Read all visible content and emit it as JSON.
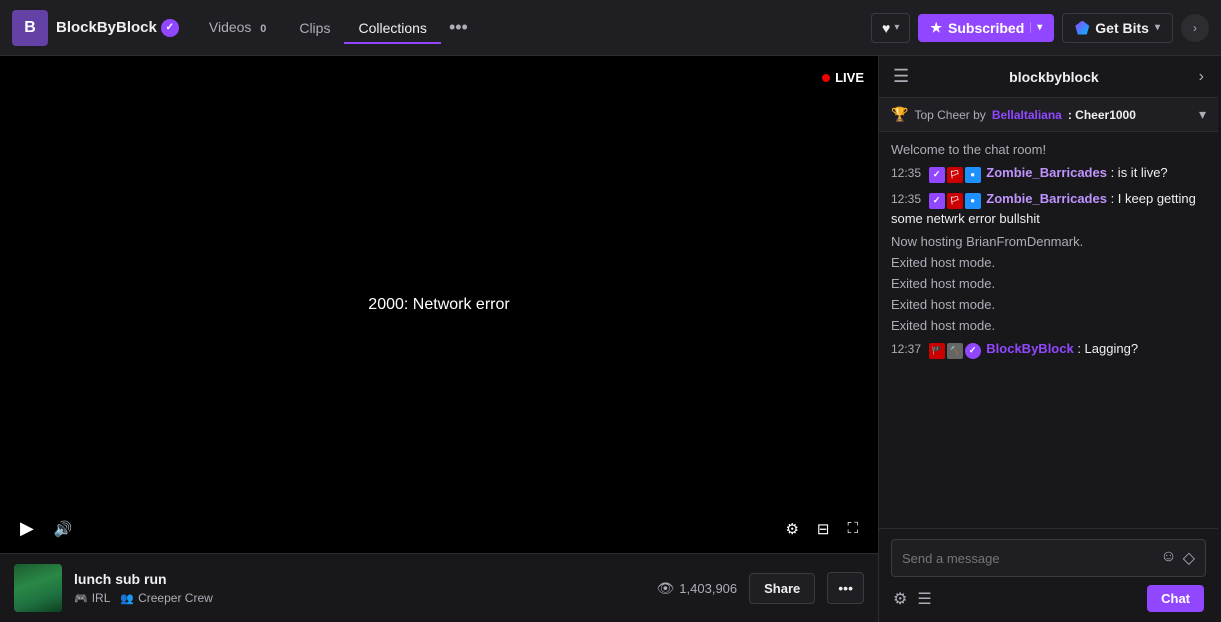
{
  "nav": {
    "channel_logo_text": "B",
    "channel_name": "BlockByBlock",
    "verified": true,
    "links": [
      {
        "label": "Videos",
        "badge": "0",
        "active": false
      },
      {
        "label": "Clips",
        "badge": "",
        "active": false
      },
      {
        "label": "Collections",
        "badge": "",
        "active": true
      }
    ],
    "more_label": "•••",
    "heart_label": "♥",
    "subscribe_label": "Subscribed",
    "get_bits_label": "Get Bits"
  },
  "video": {
    "live_label": "LIVE",
    "error_message": "2000: Network error",
    "play_icon": "▶",
    "volume_icon": "🔊"
  },
  "stream": {
    "title": "lunch sub run",
    "tag_irl": "IRL",
    "tag_crew": "Creeper Crew",
    "viewer_count": "1,403,906",
    "share_label": "Share"
  },
  "chat": {
    "channel_name": "blockbyblock",
    "top_cheer_label": "Top Cheer by",
    "top_cheer_user": "BellaItaliana",
    "top_cheer_separator": ": Cheer",
    "top_cheer_amount": "1000",
    "welcome_message": "Welcome to the chat room!",
    "messages": [
      {
        "time": "12:35",
        "username": "Zombie_Barricades",
        "text": ": is it live?",
        "username_color": "purple"
      },
      {
        "time": "12:35",
        "username": "Zombie_Barricades",
        "text": ": I keep getting some netwrk error bullshit",
        "username_color": "purple"
      },
      {
        "time": null,
        "system": true,
        "text": "Now hosting BrianFromDenmark."
      },
      {
        "time": null,
        "system": true,
        "text": "Exited host mode."
      },
      {
        "time": null,
        "system": true,
        "text": "Exited host mode."
      },
      {
        "time": null,
        "system": true,
        "text": "Exited host mode."
      },
      {
        "time": null,
        "system": true,
        "text": "Exited host mode."
      },
      {
        "time": "12:37",
        "username": "BlockByBlock",
        "text": ": Lagging?",
        "username_color": "channel"
      }
    ],
    "input_placeholder": "Send a message",
    "send_label": "Chat"
  }
}
